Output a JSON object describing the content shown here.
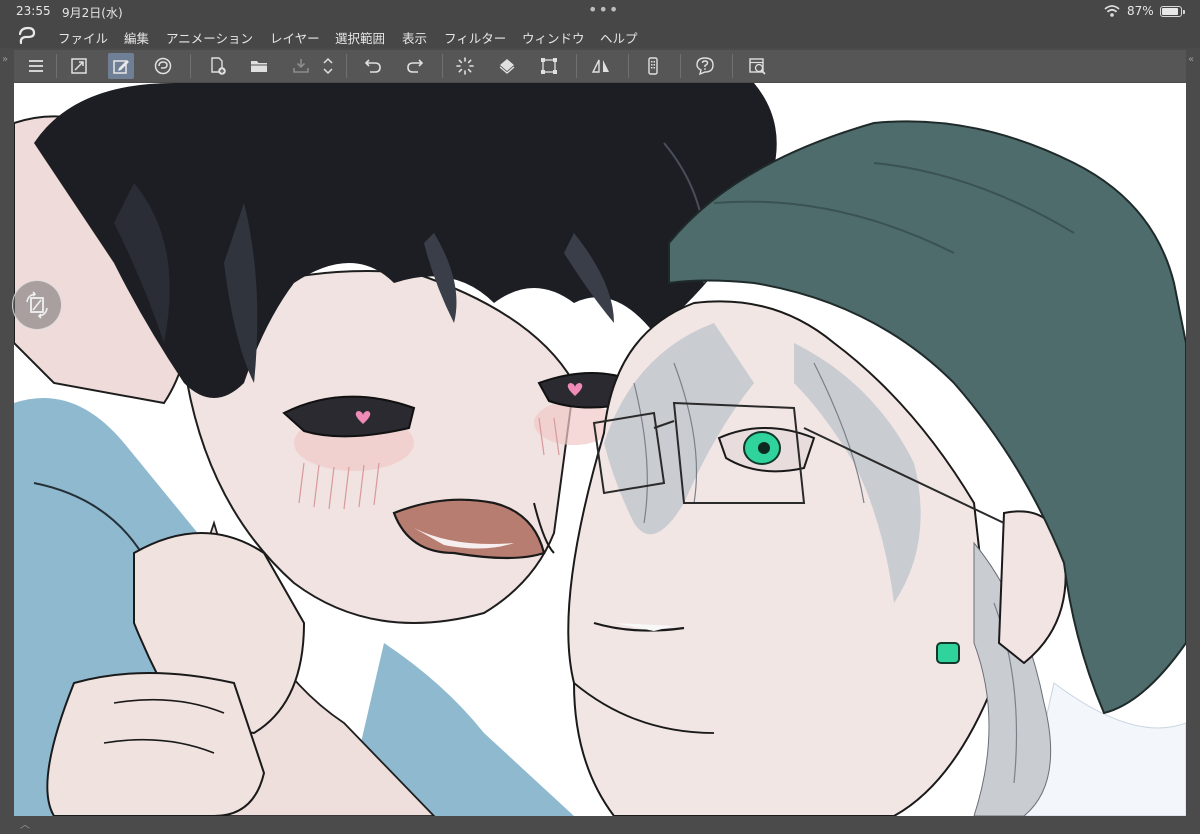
{
  "status_bar": {
    "time": "23:55",
    "date": "9月2日(水)",
    "battery": "87%"
  },
  "menu": {
    "items": [
      "ファイル",
      "編集",
      "アニメーション",
      "レイヤー",
      "選択範囲",
      "表示",
      "フィルター",
      "ウィンドウ",
      "ヘルプ"
    ]
  },
  "toolbar": {
    "buttons": [
      "hamburger-menu-icon",
      "fullscreen-icon",
      "edit-canvas-icon",
      "clip-studio-icon",
      "new-file-icon",
      "open-folder-icon",
      "save-icon",
      "scroll-arrows-icon",
      "undo-icon",
      "redo-icon",
      "loading-icon",
      "fill-icon",
      "transform-icon",
      "flip-horizontal-icon",
      "smartphone-icon",
      "help-icon",
      "canvas-settings-icon"
    ]
  },
  "colors": {
    "ui_dark": "#474747",
    "toolbar": "#565656",
    "active_tool": "#6f7f96",
    "canvas_bg": "#ffffff",
    "hair_black": "#1c1e24",
    "hat_teal": "#4f6c6c",
    "skin": "#f1e3e1",
    "shirt_blue": "#8fb9cf",
    "hair_silver": "#c9ccd1",
    "eye_green": "#2fd39b"
  }
}
